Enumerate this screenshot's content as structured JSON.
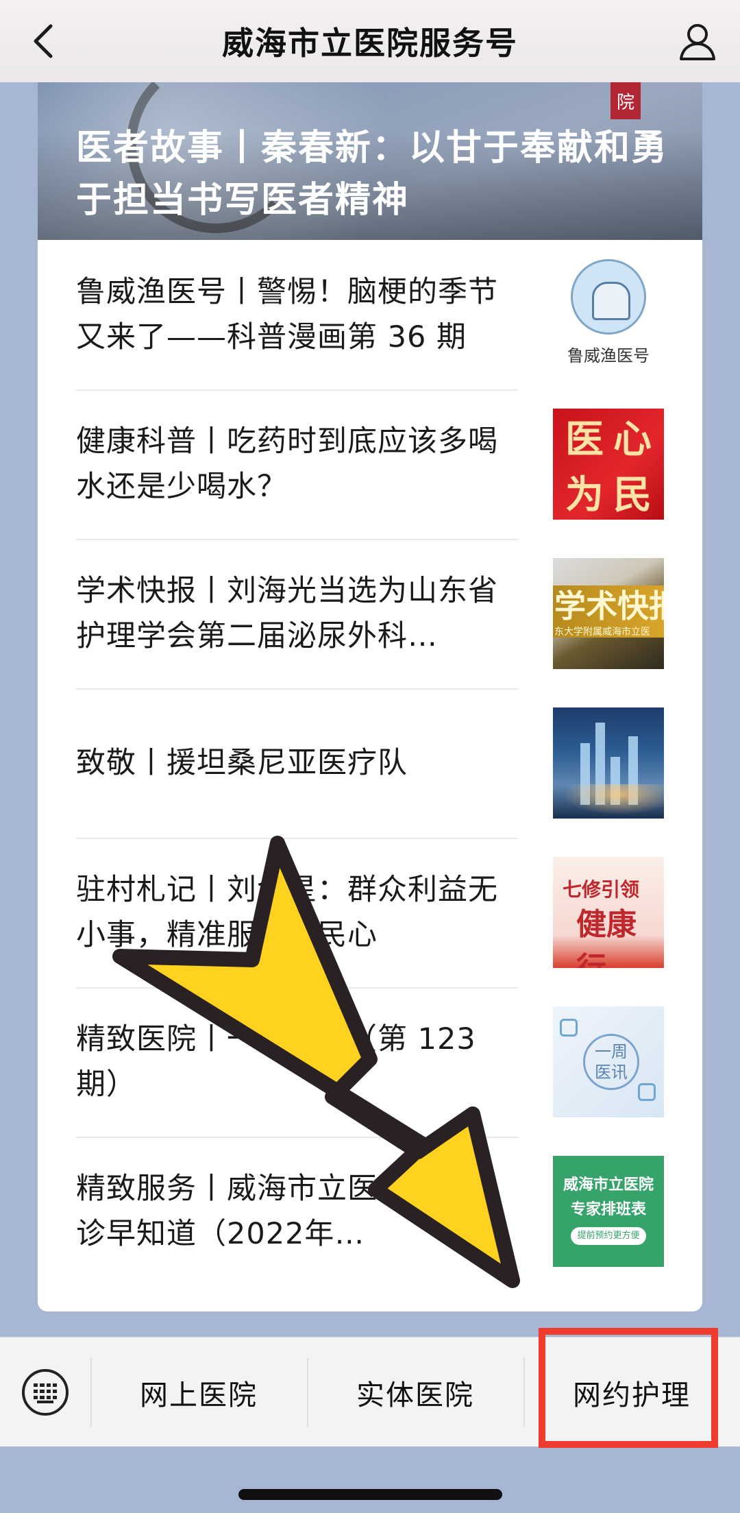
{
  "header": {
    "title": "威海市立医院服务号",
    "back_icon": "chevron-left-icon",
    "profile_icon": "user-icon"
  },
  "hero": {
    "title": "医者故事丨秦春新：以甘于奉献和勇于担当书写医者精神",
    "seal_text": "院"
  },
  "articles": [
    {
      "title": "鲁威渔医号丨警惕！脑梗的季节又来了——科普漫画第 36 期",
      "thumb_caption": "鲁威渔医号"
    },
    {
      "title": "健康科普丨吃药时到底应该多喝水还是少喝水？",
      "thumb_glyphs": [
        "医",
        "心",
        "为",
        "民"
      ]
    },
    {
      "title": "学术快报丨刘海光当选为山东省护理学会第二届泌尿外科…",
      "thumb_text": "学术快报",
      "thumb_subtext": "东大学附属威海市立医"
    },
    {
      "title": "致敬丨援坦桑尼亚医疗队"
    },
    {
      "title": "驻村札记丨刘金星：群众利益无小事，精准服务暖民心",
      "thumb_line1": "七修引领",
      "thumb_line2": "健康行"
    },
    {
      "title": "精致医院丨一周医讯（第 123 期）",
      "thumb_text": "一周\n医讯"
    },
    {
      "title": "精致服务丨威海市立医院专家坐诊早知道（2022年…",
      "thumb_line1": "威海市立医院",
      "thumb_line2": "专家排班表",
      "thumb_button": "提前预约更方便"
    }
  ],
  "bottom_menu": {
    "keyboard_icon": "keyboard-icon",
    "items": [
      "网上医院",
      "实体医院",
      "网约护理"
    ]
  },
  "colors": {
    "highlight": "#f03c2e",
    "arrow_fill": "#ffd21f",
    "arrow_stroke": "#2a2222"
  }
}
